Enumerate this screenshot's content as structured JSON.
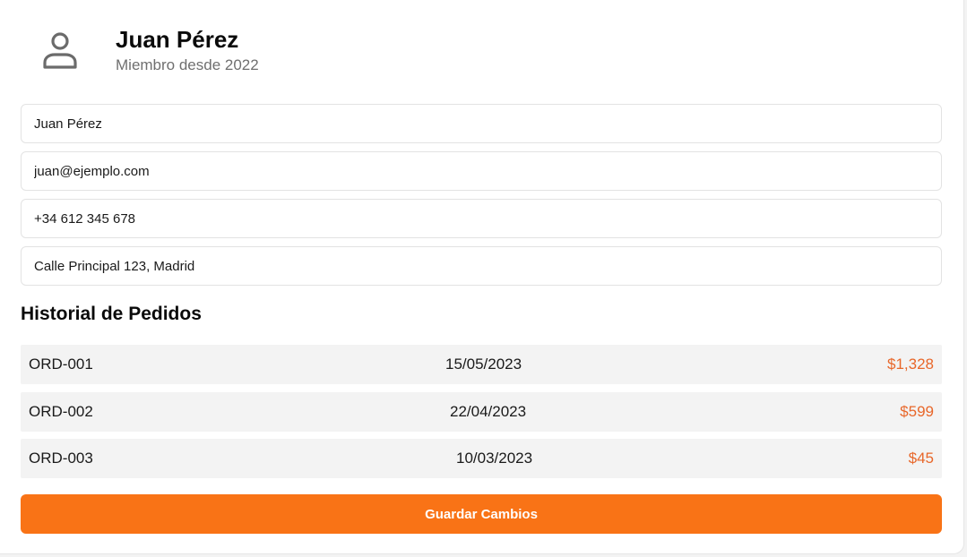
{
  "profile": {
    "avatar_icon": "user-icon",
    "name": "Juan Pérez",
    "member_since": "Miembro desde 2022"
  },
  "form": {
    "name_value": "Juan Pérez",
    "email_value": "juan@ejemplo.com",
    "phone_value": "+34 612 345 678",
    "address_value": "Calle Principal 123, Madrid"
  },
  "orders": {
    "title": "Historial de Pedidos",
    "items": [
      {
        "id": "ORD-001",
        "date": "15/05/2023",
        "amount": "$1,328"
      },
      {
        "id": "ORD-002",
        "date": "22/04/2023",
        "amount": "$599"
      },
      {
        "id": "ORD-003",
        "date": "10/03/2023",
        "amount": "$45"
      }
    ]
  },
  "actions": {
    "save_label": "Guardar Cambios"
  },
  "colors": {
    "accent": "#f97316",
    "amount": "#e8672a",
    "row_bg": "#f3f3f3",
    "muted_text": "#6f6f6f"
  }
}
